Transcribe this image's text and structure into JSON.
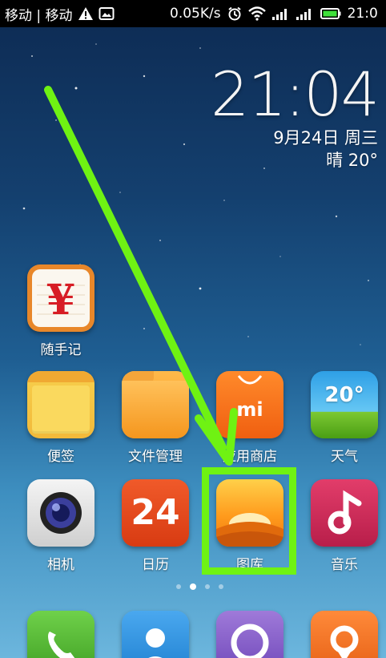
{
  "status_bar": {
    "carrier": "移动 | 移动",
    "speed": "0.05K/s",
    "time": "21:0",
    "icons": [
      "warning-icon",
      "image-notification-icon",
      "alarm-icon",
      "wifi-icon",
      "signal-icon",
      "signal-icon",
      "battery-icon"
    ]
  },
  "clock_widget": {
    "time": "21:04",
    "date": "9月24日 周三",
    "weather": "晴  20°"
  },
  "apps": [
    {
      "name": "suishouji",
      "label": "随手记",
      "icon": "yen-icon"
    },
    {
      "name": "notes",
      "label": "便签",
      "icon": "notes-icon"
    },
    {
      "name": "file-manager",
      "label": "文件管理",
      "icon": "folder-icon"
    },
    {
      "name": "app-store",
      "label": "应用商店",
      "icon": "shopping-bag-icon",
      "glyph": "mi"
    },
    {
      "name": "weather",
      "label": "天气",
      "icon": "weather-icon",
      "glyph": "20°"
    },
    {
      "name": "camera",
      "label": "相机",
      "icon": "camera-icon"
    },
    {
      "name": "calendar",
      "label": "日历",
      "icon": "calendar-icon",
      "glyph": "24"
    },
    {
      "name": "gallery",
      "label": "图库",
      "icon": "gallery-icon"
    },
    {
      "name": "music",
      "label": "音乐",
      "icon": "music-note-icon"
    }
  ],
  "dock": [
    {
      "name": "phone",
      "icon": "phone-icon"
    },
    {
      "name": "contacts",
      "icon": "contacts-icon"
    },
    {
      "name": "messages",
      "icon": "chat-icon"
    },
    {
      "name": "browser",
      "icon": "location-pin-icon"
    }
  ],
  "page_indicator": {
    "pages": 4,
    "active": 2
  },
  "annotation": {
    "highlight_color": "#6ff213",
    "target": "gallery"
  }
}
